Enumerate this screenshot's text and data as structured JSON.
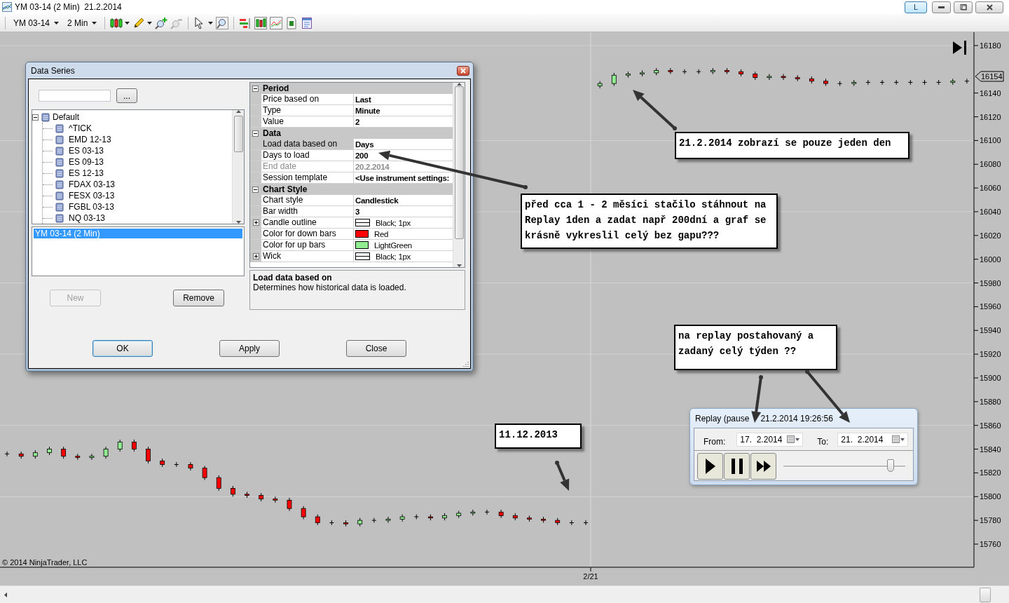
{
  "window": {
    "title": "YM 03-14 (2 Min)  21.2.2014",
    "layout_button": {
      "label": "L",
      "selected": true
    }
  },
  "toolbar": {
    "instrument": "YM 03-14",
    "interval": "2 Min"
  },
  "chart": {
    "copyright": "© 2014 NinjaTrader, LLC",
    "price_marker": "16154",
    "date_label": "2/21",
    "chart_data": {
      "type": "candlestick",
      "grid": true,
      "ylim": [
        15740.5,
        16191.2
      ],
      "yticks": [
        16180,
        16140,
        16120,
        16100,
        16080,
        16060,
        16040,
        16020,
        16000,
        15980,
        15960,
        15940,
        15920,
        15900,
        15880,
        15860,
        15840,
        15820,
        15800,
        15780,
        15760
      ],
      "ohlc": [
        [
          15836,
          15838,
          15834,
          15836
        ],
        [
          15836,
          15838,
          15832,
          15834
        ],
        [
          15834,
          15839,
          15832,
          15837
        ],
        [
          15837,
          15842,
          15835,
          15840
        ],
        [
          15840,
          15842,
          15832,
          15834
        ],
        [
          15834,
          15836,
          15831,
          15833
        ],
        [
          15833,
          15836,
          15831,
          15834
        ],
        [
          15834,
          15842,
          15832,
          15840
        ],
        [
          15840,
          15848,
          15838,
          15846
        ],
        [
          15846,
          15848,
          15838,
          15840
        ],
        [
          15840,
          15842,
          15828,
          15830
        ],
        [
          15830,
          15832,
          15825,
          15827
        ],
        [
          15827,
          15829,
          15825,
          15827
        ],
        [
          15827,
          15829,
          15822,
          15824
        ],
        [
          15824,
          15826,
          15814,
          15816
        ],
        [
          15816,
          15818,
          15805,
          15807
        ],
        [
          15807,
          15809,
          15800,
          15802
        ],
        [
          15802,
          15804,
          15799,
          15801
        ],
        [
          15801,
          15803,
          15796,
          15798
        ],
        [
          15798,
          15800,
          15795,
          15797
        ],
        [
          15797,
          15799,
          15788,
          15790
        ],
        [
          15790,
          15792,
          15781,
          15783
        ],
        [
          15783,
          15785,
          15776,
          15778
        ],
        [
          15778,
          15780,
          15776,
          15778
        ],
        [
          15778,
          15780,
          15775,
          15777
        ],
        [
          15777,
          15782,
          15775,
          15780
        ],
        [
          15780,
          15782,
          15778,
          15780
        ],
        [
          15780,
          15783,
          15778,
          15781
        ],
        [
          15781,
          15785,
          15779,
          15783
        ],
        [
          15783,
          15785,
          15781,
          15783
        ],
        [
          15783,
          15785,
          15780,
          15782
        ],
        [
          15782,
          15786,
          15780,
          15784
        ],
        [
          15784,
          15788,
          15782,
          15786
        ],
        [
          15786,
          15789,
          15784,
          15787
        ],
        [
          15787,
          15789,
          15785,
          15787
        ],
        [
          15787,
          15789,
          15782,
          15784
        ],
        [
          15784,
          15786,
          15780,
          15782
        ],
        [
          15782,
          15784,
          15779,
          15781
        ],
        [
          15781,
          15783,
          15778,
          15780
        ],
        [
          15780,
          15782,
          15776,
          15778
        ],
        [
          15778,
          15780,
          15776,
          15778
        ],
        [
          15778,
          15780,
          15776,
          15778
        ],
        [
          16146,
          16150,
          16144,
          16148
        ],
        [
          16148,
          16157,
          16146,
          16155
        ],
        [
          16155,
          16158,
          16153,
          16156
        ],
        [
          16156,
          16159,
          16154,
          16157
        ],
        [
          16157,
          16161,
          16155,
          16159
        ],
        [
          16159,
          16161,
          16156,
          16158
        ],
        [
          16158,
          16160,
          16156,
          16158
        ],
        [
          16158,
          16160,
          16156,
          16158
        ],
        [
          16158,
          16161,
          16156,
          16159
        ],
        [
          16159,
          16161,
          16156,
          16158
        ],
        [
          16158,
          16160,
          16154,
          16156
        ],
        [
          16156,
          16158,
          16151,
          16153
        ],
        [
          16153,
          16156,
          16151,
          16154
        ],
        [
          16154,
          16156,
          16151,
          16153
        ],
        [
          16153,
          16155,
          16150,
          16152
        ],
        [
          16152,
          16154,
          16148,
          16150
        ],
        [
          16150,
          16152,
          16146,
          16148
        ],
        [
          16148,
          16150,
          16146,
          16148
        ],
        [
          16148,
          16151,
          16146,
          16149
        ],
        [
          16149,
          16151,
          16147,
          16149
        ],
        [
          16149,
          16151,
          16147,
          16149
        ],
        [
          16149,
          16151,
          16147,
          16149
        ],
        [
          16149,
          16151,
          16147,
          16149
        ],
        [
          16149,
          16151,
          16147,
          16149
        ],
        [
          16149,
          16151,
          16147,
          16149
        ],
        [
          16149,
          16152,
          16147,
          16150
        ],
        [
          16150,
          16152,
          16148,
          16150
        ]
      ]
    }
  },
  "data_series_dialog": {
    "title": "Data Series",
    "browse_button": "...",
    "tree": [
      {
        "label": "Default",
        "expanded": true,
        "children": [
          {
            "label": "^TICK"
          },
          {
            "label": "EMD 12-13"
          },
          {
            "label": "ES 03-13"
          },
          {
            "label": "ES 09-13"
          },
          {
            "label": "ES 12-13"
          },
          {
            "label": "FDAX 03-13"
          },
          {
            "label": "FESX 03-13"
          },
          {
            "label": "FGBL 03-13"
          },
          {
            "label": "NQ 03-13"
          }
        ]
      }
    ],
    "series_list": [
      {
        "label": "YM 03-14 (2 Min)",
        "selected": true
      }
    ],
    "buttons": [
      {
        "label": "New",
        "disabled": true
      },
      {
        "label": "Remove",
        "disabled": false
      }
    ],
    "properties": [
      {
        "category": "Period",
        "expanded": true,
        "items": [
          {
            "name": "Price based on",
            "value": "Last",
            "kind": "text",
            "expandable": false,
            "selected": false,
            "disabled": false
          },
          {
            "name": "Type",
            "value": "Minute",
            "kind": "text",
            "expandable": false,
            "selected": false,
            "disabled": false
          },
          {
            "name": "Value",
            "value": "2",
            "kind": "text",
            "expandable": false,
            "selected": false,
            "disabled": false
          }
        ]
      },
      {
        "category": "Data",
        "expanded": true,
        "items": [
          {
            "name": "Load data based on",
            "value": "Days",
            "kind": "text",
            "expandable": false,
            "selected": true,
            "disabled": false
          },
          {
            "name": "Days to load",
            "value": "200",
            "kind": "text",
            "expandable": false,
            "selected": false,
            "disabled": false
          },
          {
            "name": "End date",
            "value": "20.2.2014",
            "kind": "text",
            "expandable": false,
            "selected": false,
            "disabled": true
          },
          {
            "name": "Session template",
            "value": "<Use instrument settings:",
            "kind": "text",
            "expandable": false,
            "selected": false,
            "disabled": false
          }
        ]
      },
      {
        "category": "Chart Style",
        "expanded": true,
        "items": [
          {
            "name": "Chart style",
            "value": "Candlestick",
            "kind": "text",
            "expandable": false,
            "selected": false,
            "disabled": false
          },
          {
            "name": "Bar width",
            "value": "3",
            "kind": "text",
            "expandable": false,
            "selected": false,
            "disabled": false
          },
          {
            "name": "Candle outline",
            "value": "Black; 1px",
            "kind": "line",
            "expandable": true,
            "selected": false,
            "disabled": false
          },
          {
            "name": "Color for down bars",
            "value": "Red",
            "kind": "color",
            "color": "#ff0000",
            "expandable": false,
            "selected": false,
            "disabled": false
          },
          {
            "name": "Color for up bars",
            "value": "LightGreen",
            "kind": "color",
            "color": "#90ee90",
            "expandable": false,
            "selected": false,
            "disabled": false
          },
          {
            "name": "Wick",
            "value": "Black; 1px",
            "kind": "line",
            "expandable": true,
            "selected": false,
            "disabled": false
          }
        ]
      }
    ],
    "description": {
      "title": "Load data based on",
      "text": "Determines how historical data is loaded."
    },
    "footer_buttons": [
      {
        "label": "OK",
        "focused": true
      },
      {
        "label": "Apply",
        "focused": false
      },
      {
        "label": "Close",
        "focused": false
      }
    ]
  },
  "replay": {
    "title": [
      "Replay (pause",
      "21.2.2014 19:26:56"
    ],
    "from_label": "From:",
    "from_value": "17.  2.2014",
    "to_label": "To:",
    "to_value": "21.  2.2014",
    "speed": {
      "level": 0.88
    }
  },
  "annotations": [
    {
      "text": "21.2.2014  zobrazí se pouze jeden den"
    },
    {
      "text": "před cca 1 - 2 měsíci stačilo stáhnout na Replay 1den a zadat např 200dní a graf se krásně vykreslil celý bez gapu???"
    },
    {
      "text": "na replay postahovaný a zadaný celý týden ??"
    },
    {
      "text": "11.12.2013"
    }
  ]
}
